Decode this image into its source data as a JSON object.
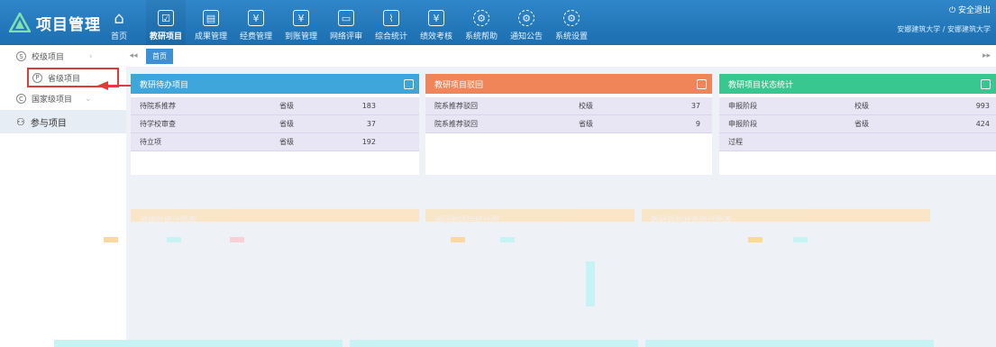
{
  "app": {
    "title": "项目管理"
  },
  "nav": [
    {
      "label": "首页",
      "icon": "home-icon"
    },
    {
      "label": "教研项目",
      "icon": "clipboard-icon",
      "active": true
    },
    {
      "label": "成果管理",
      "icon": "trophy-icon"
    },
    {
      "label": "经费管理",
      "icon": "yen-icon"
    },
    {
      "label": "到账管理",
      "icon": "yen-icon"
    },
    {
      "label": "网络评审",
      "icon": "folder-icon"
    },
    {
      "label": "综合统计",
      "icon": "chart-icon"
    },
    {
      "label": "绩效考核",
      "icon": "yen-icon"
    },
    {
      "label": "系统帮助",
      "icon": "gear-icon"
    },
    {
      "label": "通知公告",
      "icon": "gear-icon"
    },
    {
      "label": "系统设置",
      "icon": "gear-icon"
    }
  ],
  "top_right": {
    "logout": "安全退出",
    "users": "安娜建筑大学 / 安娜建筑大学"
  },
  "sidebar": {
    "items": [
      {
        "label": "校级项目",
        "marker": "S"
      },
      {
        "label": "省级项目",
        "marker": "P"
      },
      {
        "label": "国家级项目",
        "marker": "C"
      },
      {
        "label": "参与项目",
        "marker": ""
      }
    ]
  },
  "tabs": {
    "home": "首页"
  },
  "panels": {
    "todo": {
      "title": "教研待办项目",
      "color": "#3fa6dc",
      "rows": [
        {
          "name": "待院系推荐",
          "level": "省级",
          "count": "183"
        },
        {
          "name": "待学校审查",
          "level": "省级",
          "count": "37"
        },
        {
          "name": "待立项",
          "level": "省级",
          "count": "192"
        }
      ]
    },
    "rejected": {
      "title": "教研项目驳回",
      "color": "#f0855a",
      "rows": [
        {
          "name": "院系推荐驳回",
          "level": "校级",
          "count": "37"
        },
        {
          "name": "院系推荐驳回",
          "level": "省级",
          "count": "9"
        }
      ]
    },
    "status": {
      "title": "教研项目状态统计",
      "color": "#38c78e",
      "rows": [
        {
          "name": "申报阶段",
          "level": "校级",
          "count": "993"
        },
        {
          "name": "申报阶段",
          "level": "省级",
          "count": "424"
        },
        {
          "name": "过程",
          "level": "",
          "count": ""
        }
      ]
    }
  },
  "sub_panels": {
    "a": "待审批统计图表",
    "b": "退回的项目统计图",
    "c": "教研项目状态统计图表"
  }
}
